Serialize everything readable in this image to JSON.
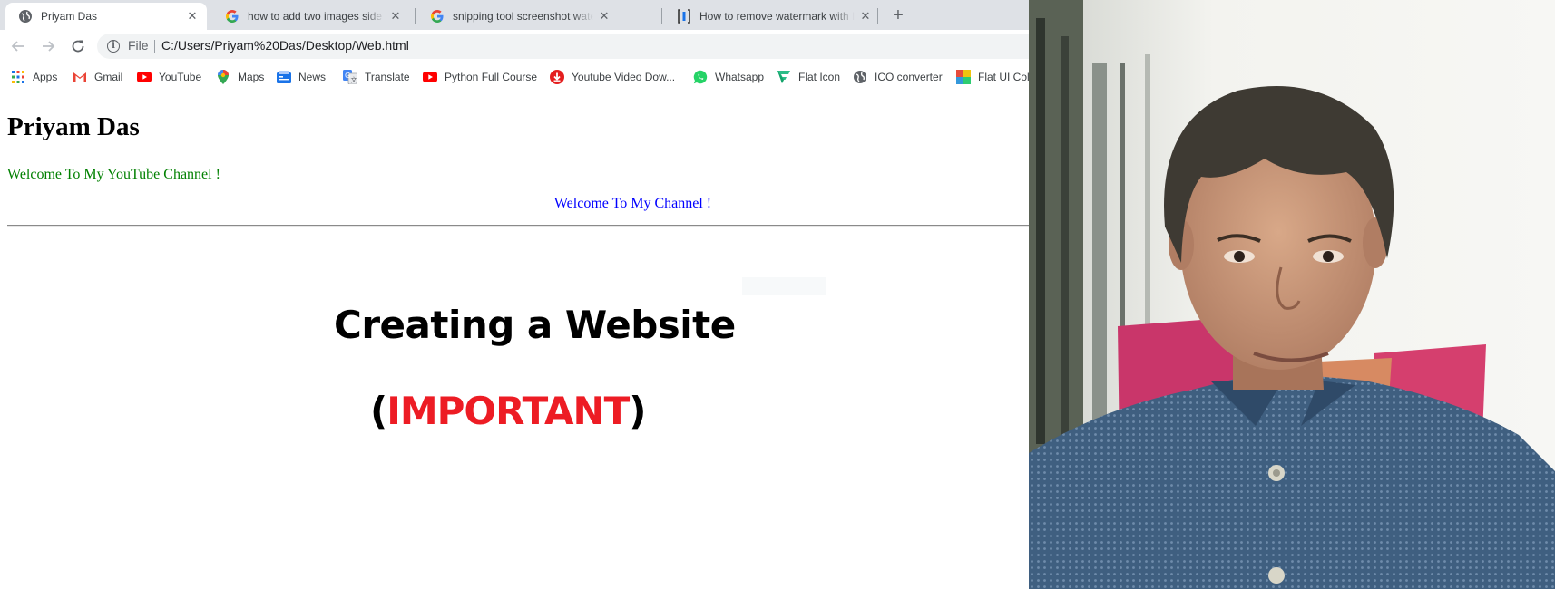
{
  "tabs": [
    {
      "title": "Priyam Das",
      "icon": "globe-icon",
      "active": true
    },
    {
      "title": "how to add two images side by side",
      "icon": "google-icon",
      "active": false
    },
    {
      "title": "snipping tool screenshot watermark",
      "icon": "google-icon",
      "active": false
    },
    {
      "title": "How to remove watermark with Inpaint",
      "icon": "inpaint-icon",
      "active": false
    }
  ],
  "toolbar": {
    "back_icon": "back-arrow-icon",
    "forward_icon": "forward-arrow-icon",
    "reload_icon": "reload-icon",
    "scheme": "File",
    "url": "C:/Users/Priyam%20Das/Desktop/Web.html"
  },
  "bookmarks": [
    {
      "label": "Apps",
      "icon": "apps-grid-icon"
    },
    {
      "label": "Gmail",
      "icon": "gmail-icon"
    },
    {
      "label": "YouTube",
      "icon": "youtube-icon"
    },
    {
      "label": "Maps",
      "icon": "maps-pin-icon"
    },
    {
      "label": "News",
      "icon": "news-icon"
    },
    {
      "label": "Translate",
      "icon": "translate-icon"
    },
    {
      "label": "Python Full Course",
      "icon": "youtube-icon"
    },
    {
      "label": "Youtube Video Dow...",
      "icon": "download-icon"
    },
    {
      "label": "Whatsapp",
      "icon": "whatsapp-icon"
    },
    {
      "label": "Flat Icon",
      "icon": "flaticon-icon"
    },
    {
      "label": "ICO converter",
      "icon": "globe-icon"
    },
    {
      "label": "Flat UI Colors",
      "icon": "flat-ui-colors-icon"
    }
  ],
  "page": {
    "heading": "Priyam Das",
    "welcome_green": "Welcome To My YouTube Channel !",
    "welcome_blue": "Welcome To My Channel !",
    "title": "Creating a Website",
    "important_open": "(",
    "important_word": "IMPORTANT",
    "important_close": ")"
  },
  "colors": {
    "tabstrip": "#dee1e6",
    "green_text": "#008000",
    "blue_text": "#0000ff",
    "important_red": "#ed1c24"
  },
  "photo": {
    "subject": "portrait-photo"
  }
}
